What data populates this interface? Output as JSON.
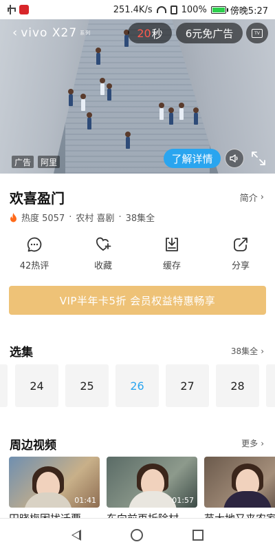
{
  "status_bar": {
    "speed": "251.4K/s",
    "battery": "100%",
    "time": "傍晚5:27",
    "battery_level": 1.0
  },
  "ad": {
    "brand": "vivo X27",
    "brand_sub": "系列",
    "countdown_num": "20",
    "countdown_unit": "秒",
    "skip_label": "6元免广告",
    "tag_ad": "广告",
    "tag_source": "阿里",
    "learn_more": "了解详情"
  },
  "show": {
    "title": "欢喜盈门",
    "intro": "简介",
    "heat": "热度 5057",
    "genre": "农村 喜剧",
    "episodes_total": "38集全"
  },
  "actions": [
    {
      "label": "42热评",
      "icon": "comment-icon"
    },
    {
      "label": "收藏",
      "icon": "heart-plus-icon"
    },
    {
      "label": "缓存",
      "icon": "download-icon"
    },
    {
      "label": "分享",
      "icon": "share-icon"
    }
  ],
  "vip_banner": "VIP半年卡5折 会员权益特惠畅享",
  "episodes_section": {
    "title": "选集",
    "more": "38集全",
    "items": [
      "24",
      "25",
      "26",
      "27",
      "28"
    ],
    "active": "26"
  },
  "related_section": {
    "title": "周边视频",
    "more": "更多",
    "videos": [
      {
        "title": "田晓梅困扰迁要",
        "duration": "01:41"
      },
      {
        "title": "东向前再拆除村",
        "duration": "01:57"
      },
      {
        "title": "苗大地又来农家",
        "duration": "02"
      }
    ]
  },
  "colors": {
    "accent_blue": "#2aa5ef",
    "vip_gold": "#eec277",
    "countdown_red": "#ff5a4e"
  }
}
